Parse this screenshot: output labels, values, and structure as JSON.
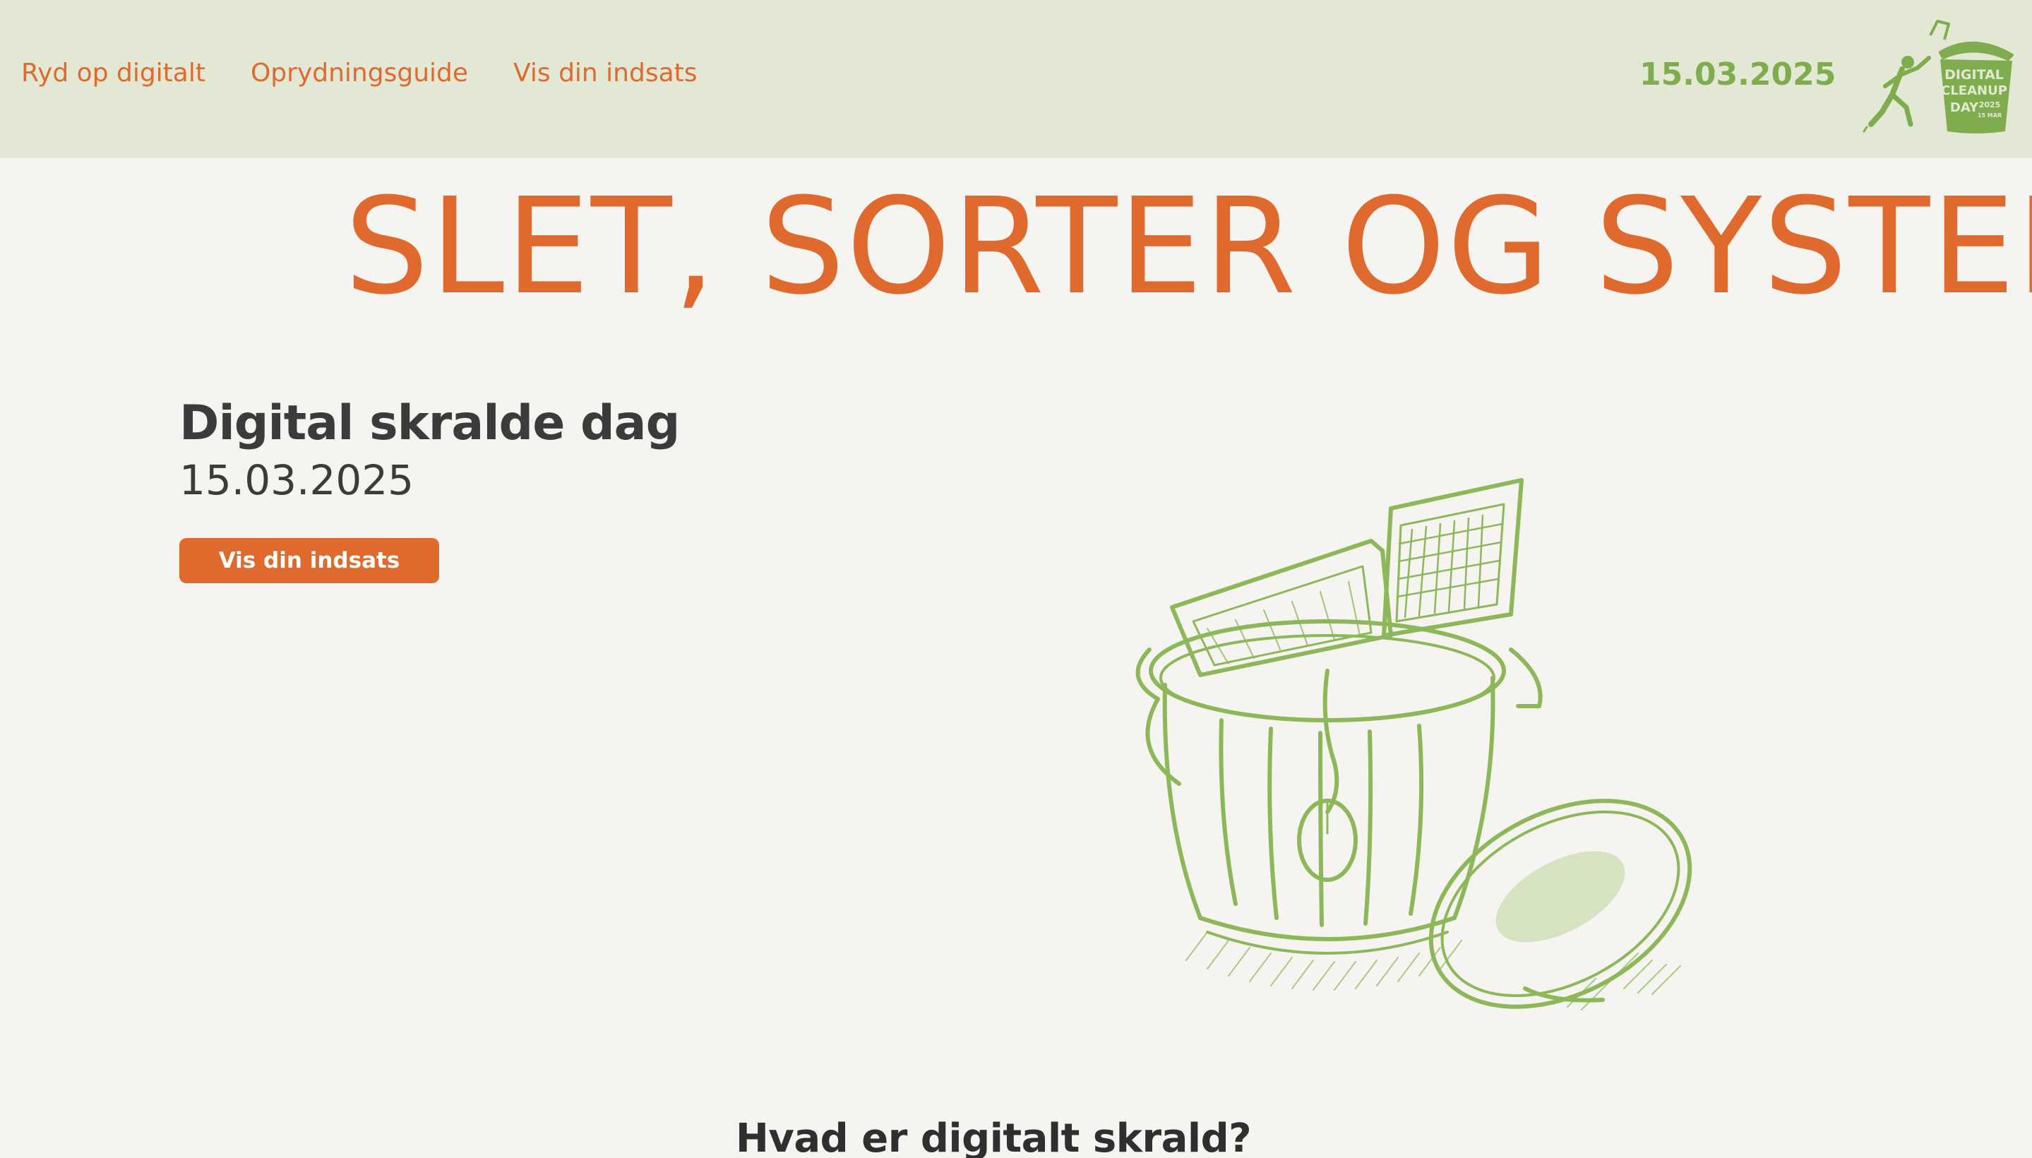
{
  "header": {
    "nav": [
      {
        "label": "Ryd op digitalt"
      },
      {
        "label": "Oprydningsguide"
      },
      {
        "label": "Vis din indsats"
      }
    ],
    "date": "15.03.2025",
    "logo": {
      "lines": [
        "DIGITAL",
        "CLEANUP",
        "DAY",
        "2025",
        "15 MAR"
      ],
      "icon": "trash-can-logo"
    }
  },
  "hero": {
    "banner": "SLET, SORTER OG SYSTEMA",
    "title": "Digital skralde dag",
    "date": "15.03.2025",
    "cta_label": "Vis din indsats",
    "illustration": "overflowing-trash-can-illustration"
  },
  "section": {
    "heading": "Hvad er digitalt skrald?"
  },
  "colors": {
    "orange": "#e06a2d",
    "green": "#7fad4e",
    "header_bg": "#e3e8d5",
    "page_bg": "#f6f4f0",
    "text_dark": "#3b3b3b"
  }
}
